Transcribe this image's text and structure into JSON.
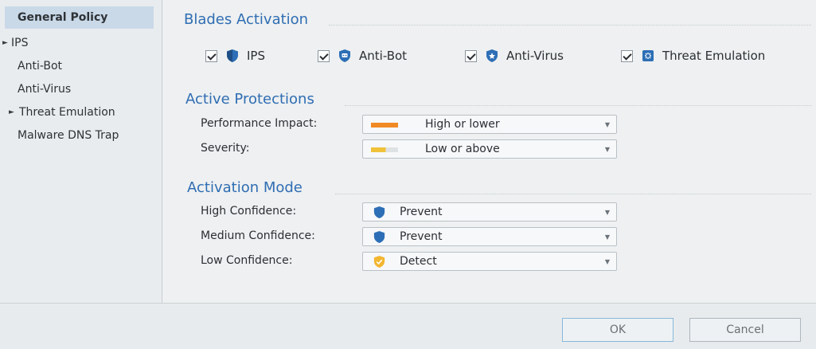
{
  "sidebar": {
    "items": [
      {
        "label": "General Policy",
        "selected": true,
        "expandable": false
      },
      {
        "label": "IPS",
        "selected": false,
        "expandable": true
      },
      {
        "label": "Anti-Bot",
        "selected": false,
        "expandable": false
      },
      {
        "label": "Anti-Virus",
        "selected": false,
        "expandable": false
      },
      {
        "label": "Threat Emulation",
        "selected": false,
        "expandable": true
      },
      {
        "label": "Malware DNS Trap",
        "selected": false,
        "expandable": false
      }
    ]
  },
  "blades": {
    "title": "Blades Activation",
    "items": [
      {
        "label": "IPS",
        "checked": true,
        "icon": "ips-shield-icon"
      },
      {
        "label": "Anti-Bot",
        "checked": true,
        "icon": "anti-bot-icon"
      },
      {
        "label": "Anti-Virus",
        "checked": true,
        "icon": "anti-virus-icon"
      },
      {
        "label": "Threat Emulation",
        "checked": true,
        "icon": "threat-emulation-icon"
      }
    ]
  },
  "protections": {
    "title": "Active Protections",
    "performance": {
      "label": "Performance Impact:",
      "value": "High or lower",
      "swatch_color": "#f08a24"
    },
    "severity": {
      "label": "Severity:",
      "value": "Low or above",
      "swatch_color": "#f0c23a"
    }
  },
  "activation": {
    "title": "Activation Mode",
    "high": {
      "label": "High Confidence:",
      "value": "Prevent",
      "icon": "prevent-shield-icon"
    },
    "medium": {
      "label": "Medium Confidence:",
      "value": "Prevent",
      "icon": "prevent-shield-icon"
    },
    "low": {
      "label": "Low Confidence:",
      "value": "Detect",
      "icon": "detect-shield-icon"
    }
  },
  "footer": {
    "ok_label": "OK",
    "cancel_label": "Cancel"
  },
  "colors": {
    "accent": "#2f6db3",
    "selected_bg": "#c9d9e8",
    "prevent_blue": "#2d6fb6",
    "detect_yellow": "#f2b630"
  }
}
